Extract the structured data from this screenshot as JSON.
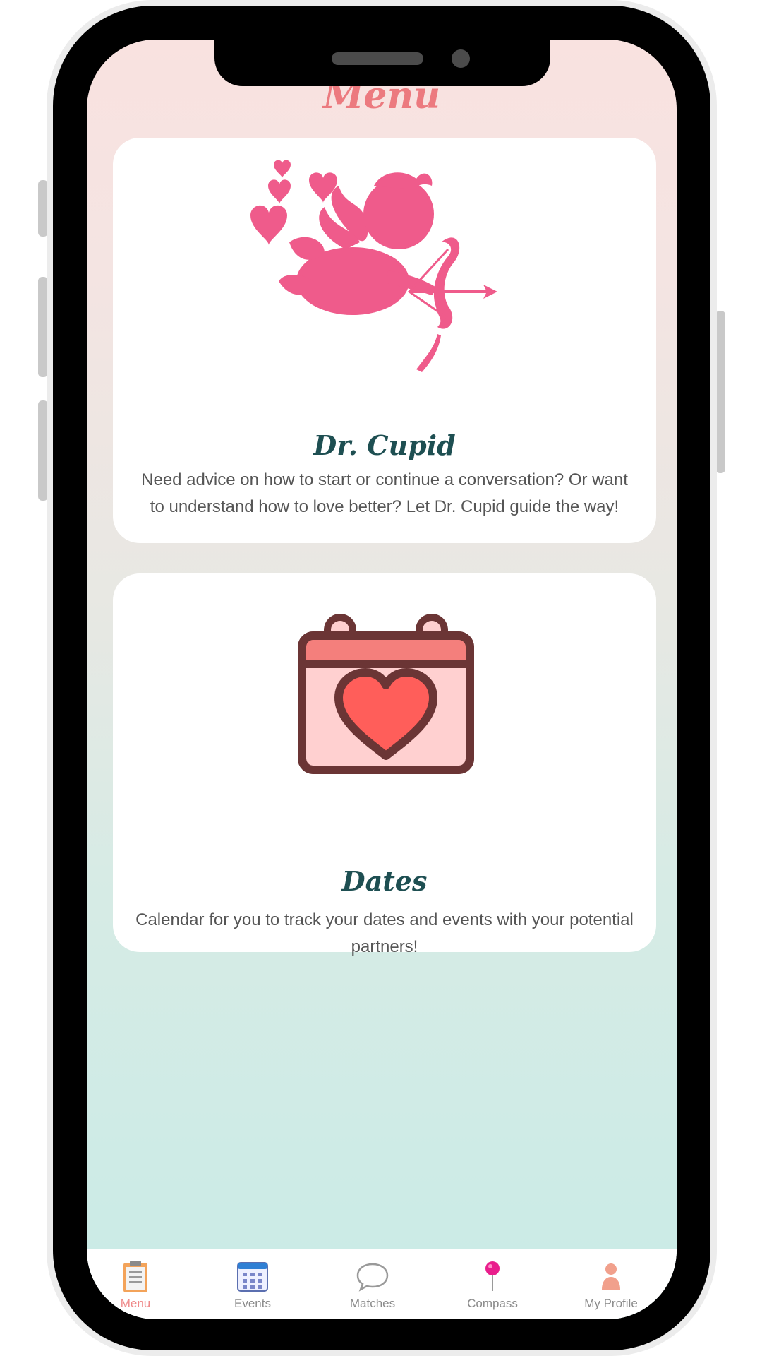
{
  "header": {
    "title": "Menu"
  },
  "cards": [
    {
      "title": "Dr. Cupid",
      "description": "Need advice on how to start or continue a conversation? Or want to understand how to love better? Let Dr. Cupid guide the way!",
      "icon": "cupid-icon"
    },
    {
      "title": "Dates",
      "description": "Calendar for you to track your dates and events with your potential partners!",
      "icon": "calendar-heart-icon"
    }
  ],
  "tabbar": {
    "active": "Menu",
    "items": [
      {
        "label": "Menu",
        "icon": "clipboard-icon"
      },
      {
        "label": "Events",
        "icon": "calendar-icon"
      },
      {
        "label": "Matches",
        "icon": "chat-bubble-icon"
      },
      {
        "label": "Compass",
        "icon": "pin-icon"
      },
      {
        "label": "My Profile",
        "icon": "person-icon"
      }
    ]
  },
  "colors": {
    "accent_pink": "#ef5c8a",
    "title_teal": "#1e4f52",
    "menu_title": "#ec7a7f",
    "active_tab": "#ef8a8a",
    "bg_top": "#f9e2e0",
    "bg_bottom": "#c9ebe6"
  }
}
